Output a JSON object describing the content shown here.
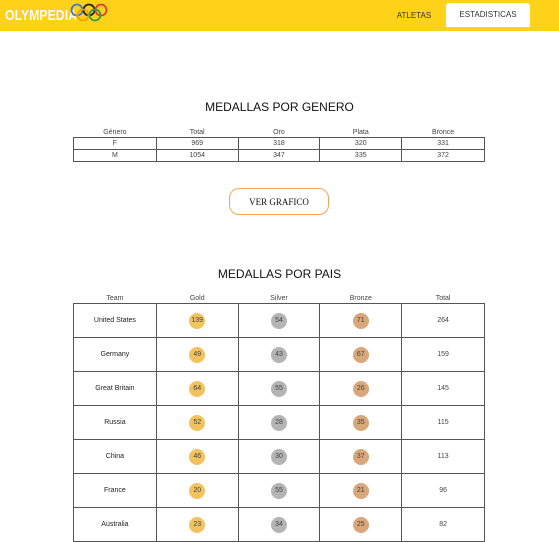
{
  "nav": {
    "logo": "OLYMPEDIA",
    "links": [
      {
        "label": "ATLETAS"
      },
      {
        "label": "ESTADISTICAS"
      }
    ]
  },
  "gender_section": {
    "title": "MEDALLAS POR GENERO",
    "headers": [
      "Género",
      "Total",
      "Oro",
      "Plata",
      "Bronce"
    ],
    "rows": [
      [
        "F",
        "969",
        "318",
        "320",
        "331"
      ],
      [
        "M",
        "1054",
        "347",
        "335",
        "372"
      ]
    ],
    "button": "VER GRAFICO"
  },
  "country_section": {
    "title": "MEDALLAS POR PAIS",
    "headers": [
      "Team",
      "Gold",
      "Silver",
      "Bronze",
      "Total"
    ],
    "rows": [
      {
        "team": "United States",
        "gold": "139",
        "silver": "54",
        "bronze": "71",
        "total": "264"
      },
      {
        "team": "Germany",
        "gold": "49",
        "silver": "43",
        "bronze": "67",
        "total": "159"
      },
      {
        "team": "Great Britain",
        "gold": "64",
        "silver": "55",
        "bronze": "26",
        "total": "145"
      },
      {
        "team": "Russia",
        "gold": "52",
        "silver": "28",
        "bronze": "35",
        "total": "115"
      },
      {
        "team": "China",
        "gold": "46",
        "silver": "30",
        "bronze": "37",
        "total": "113"
      },
      {
        "team": "France",
        "gold": "20",
        "silver": "55",
        "bronze": "21",
        "total": "96"
      },
      {
        "team": "Australia",
        "gold": "23",
        "silver": "34",
        "bronze": "25",
        "total": "82"
      }
    ]
  },
  "colors": {
    "navbar": "#ffd21a",
    "gold": "#f2c25c",
    "silver": "#b4b4b4",
    "bronze": "#d9a779",
    "button_border": "#f5a45a"
  }
}
